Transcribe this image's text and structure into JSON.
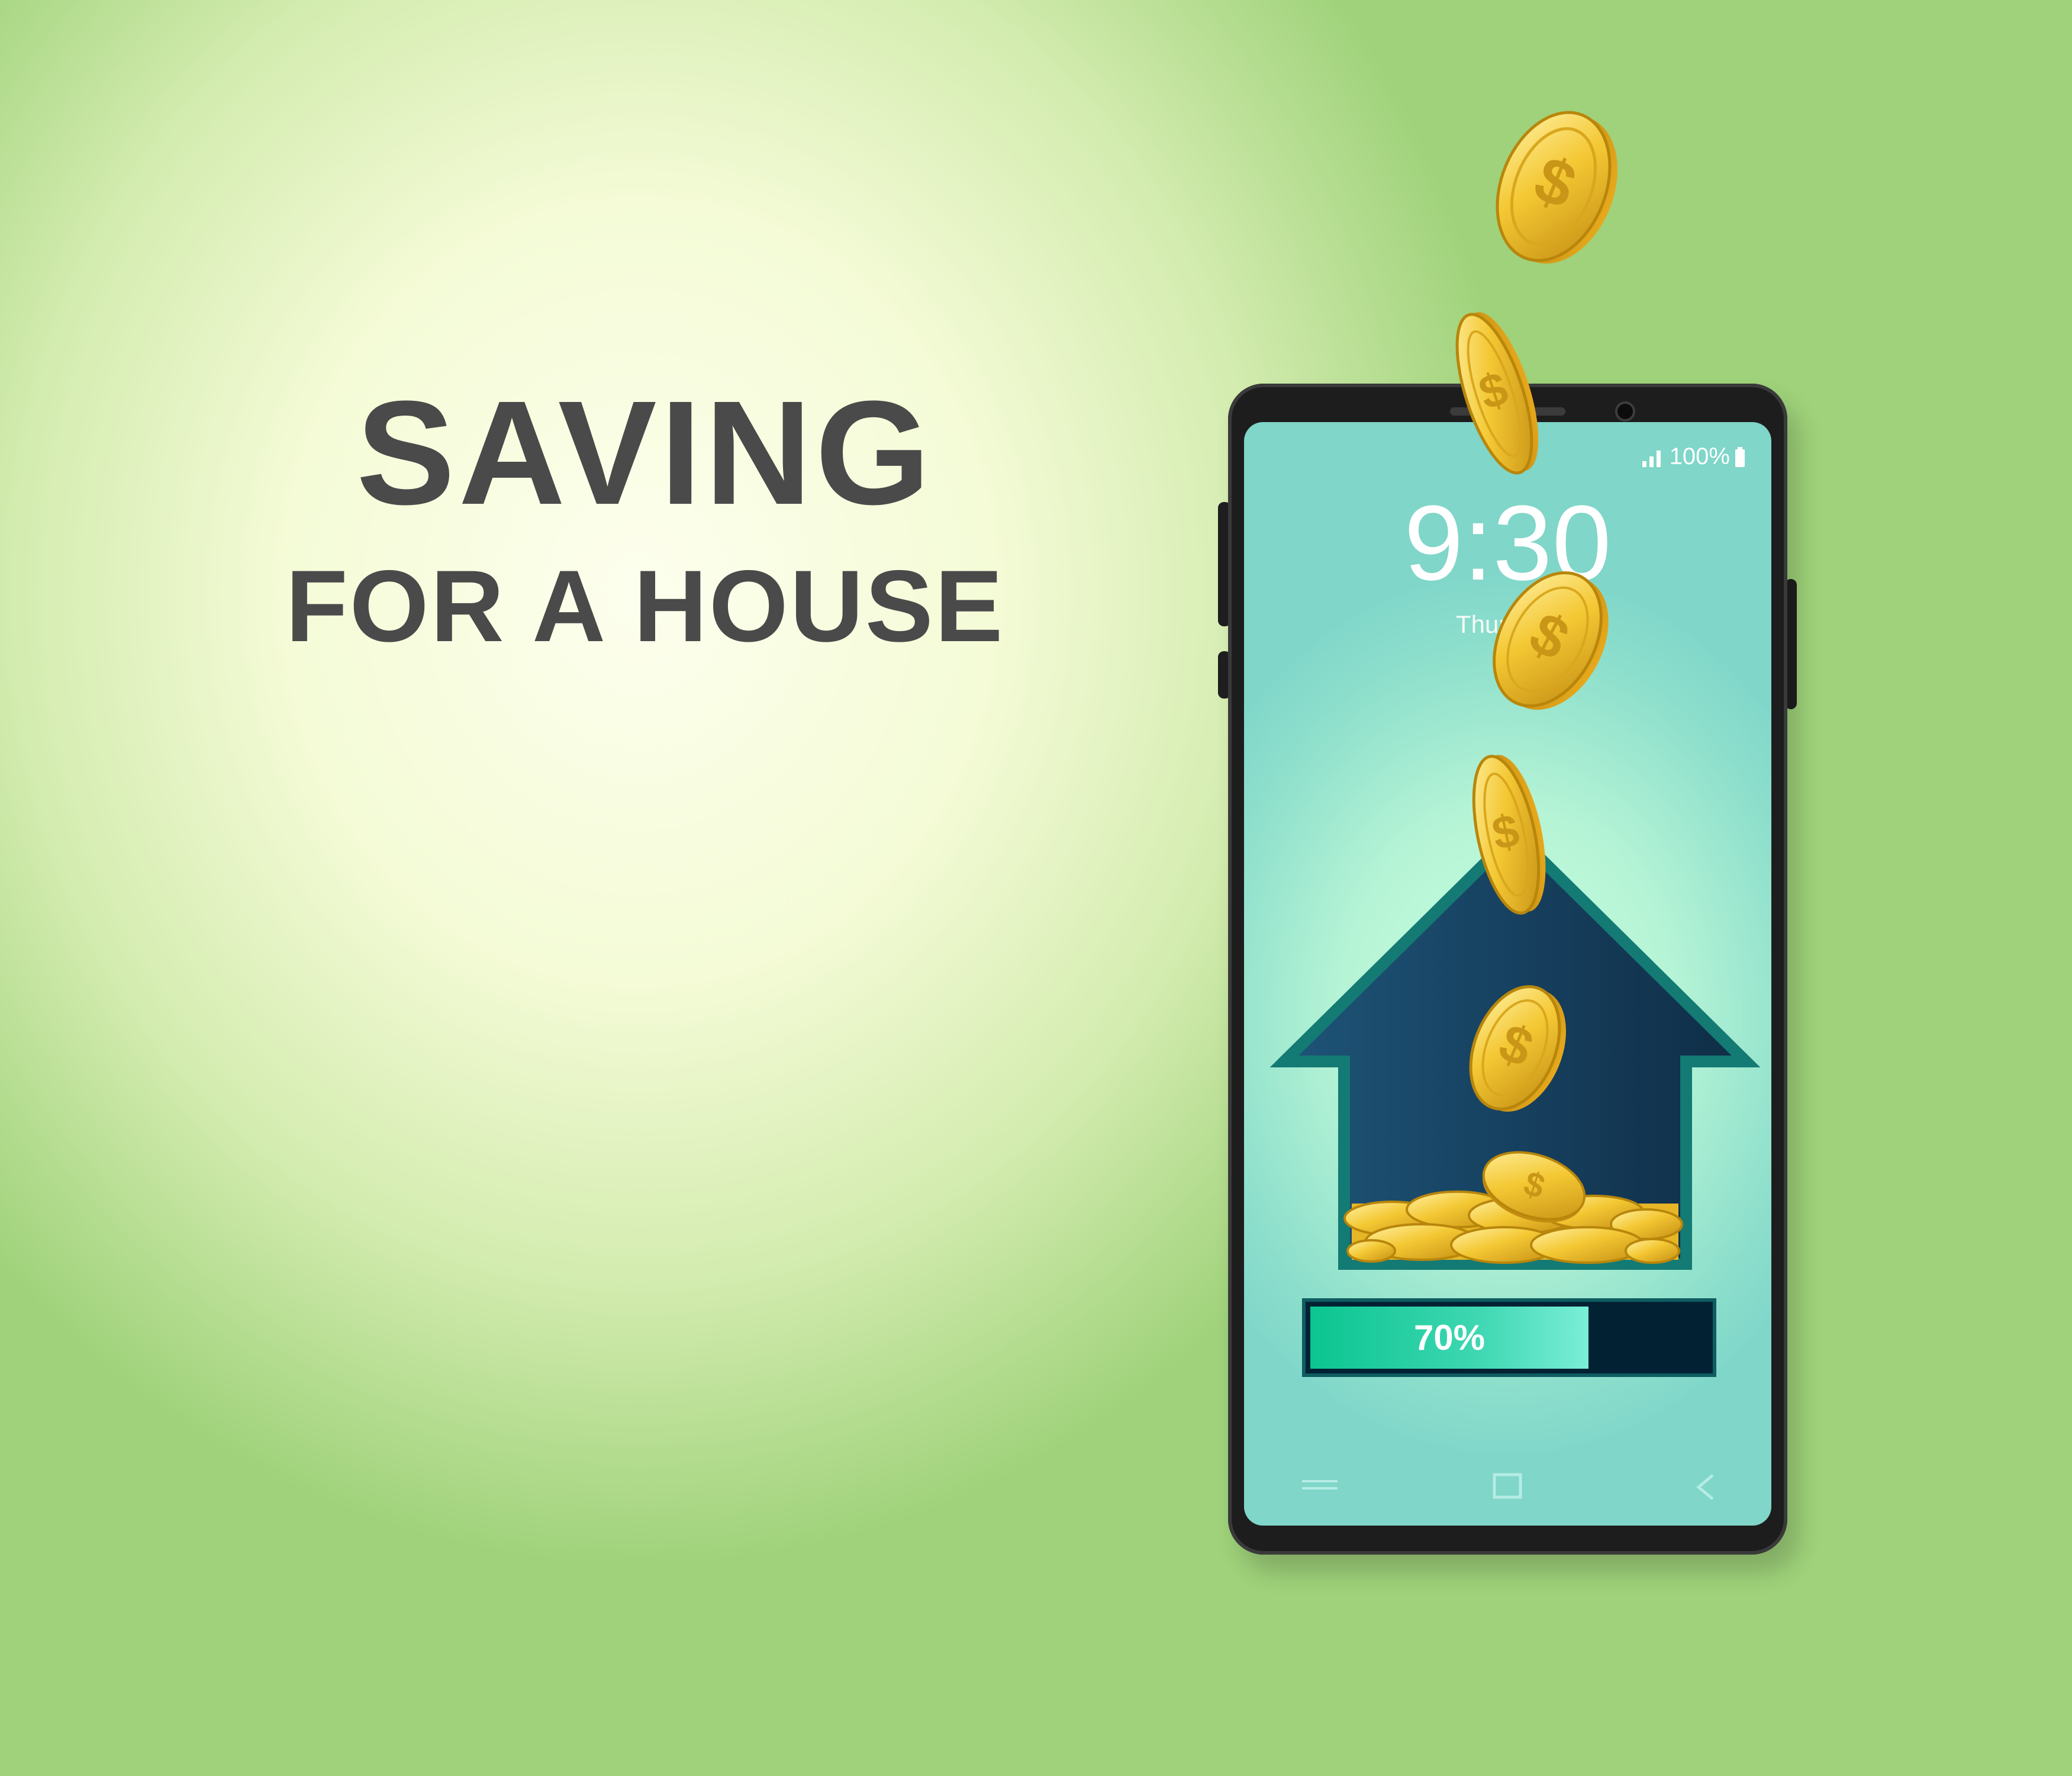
{
  "headline": {
    "line1": "SAVING",
    "line2": "FOR A HOUSE"
  },
  "phone": {
    "status": {
      "battery": "100%"
    },
    "clock": {
      "time": "9:30",
      "day": "Thursday"
    },
    "progress": {
      "label": "70%",
      "fraction": 0.7
    }
  },
  "colors": {
    "headline": "#4a4a4a",
    "house_fill": "#173f5f",
    "house_outline": "#147a74",
    "coin_gold": "#f2c42c",
    "progress_fill": "#0bc590"
  },
  "icons": {
    "signal": "signal-icon",
    "battery": "battery-icon",
    "coin": "dollar-coin-icon",
    "house": "house-icon",
    "menu": "menu-icon",
    "home": "home-square-icon",
    "back": "back-icon"
  }
}
